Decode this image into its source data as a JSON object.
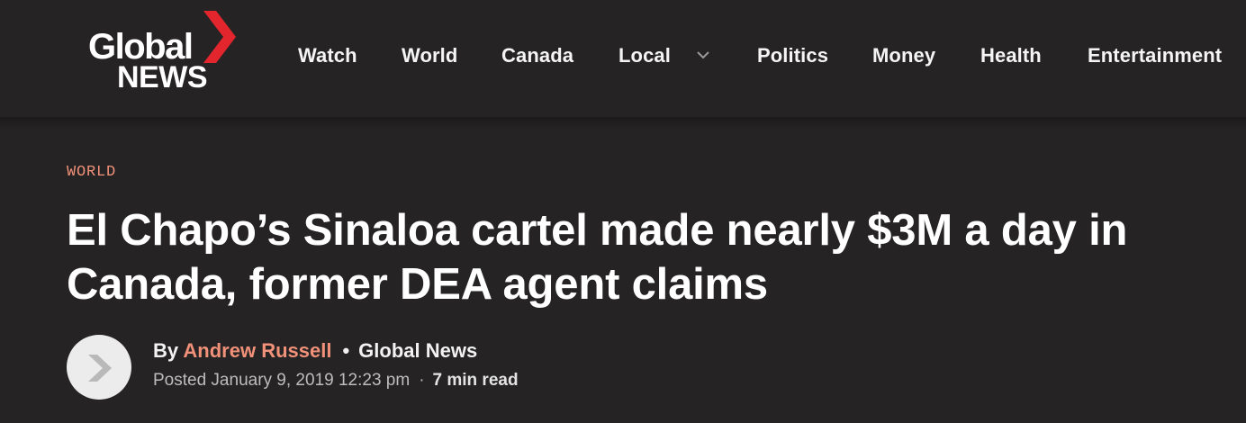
{
  "brand": {
    "logo_line1": "Global",
    "logo_line2": "NEWS",
    "accent_color": "#e3262d"
  },
  "nav": {
    "items": [
      {
        "label": "Watch"
      },
      {
        "label": "World"
      },
      {
        "label": "Canada"
      },
      {
        "label": "Local",
        "has_dropdown": true
      },
      {
        "label": "Politics"
      },
      {
        "label": "Money"
      },
      {
        "label": "Health"
      },
      {
        "label": "Entertainment"
      }
    ],
    "dropdown_icon": "chevron-down-icon"
  },
  "article": {
    "category": "WORLD",
    "headline": "El Chapo’s Sinaloa cartel made nearly $3M a day in Canada, former DEA agent claims",
    "byline": {
      "by_prefix": "By",
      "author": "Andrew Russell",
      "separator": "•",
      "outlet": "Global News"
    },
    "meta": {
      "posted": "Posted January 9, 2019 12:23 pm",
      "separator": "·",
      "read_time": "7 min read"
    },
    "avatar_icon": "global-chevron-icon"
  },
  "colors": {
    "background": "#252323",
    "link_accent": "#f2917a",
    "text": "#ffffff"
  }
}
